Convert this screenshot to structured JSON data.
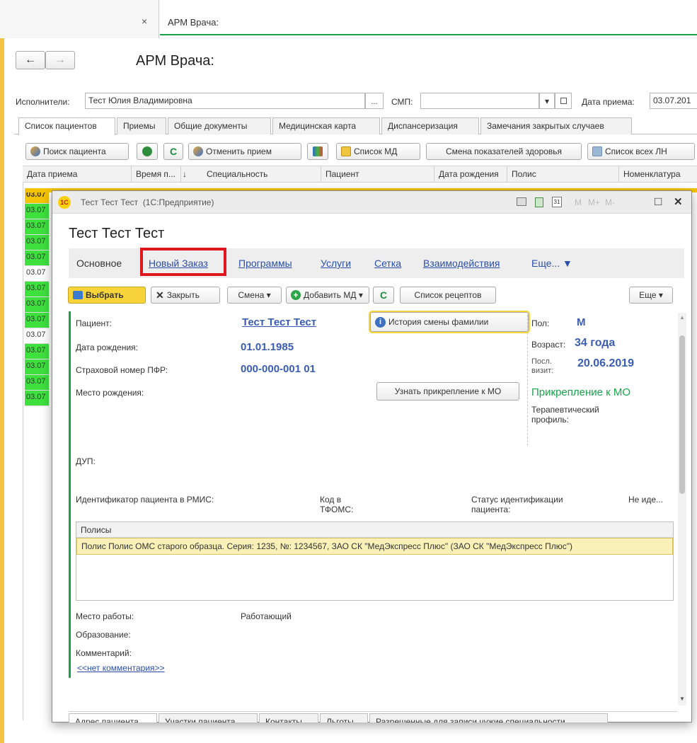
{
  "window_tab": {
    "close": "×",
    "label": "АРМ Врача:"
  },
  "page": {
    "back": "←",
    "forward": "→",
    "title": "АРМ Врача:"
  },
  "filters": {
    "executors_label": "Исполнители:",
    "executors_value": "Тест Юлия Владимировна",
    "ellipsis": "...",
    "smp_label": "СМП:",
    "smp_value": "",
    "dropdown": "▾",
    "date_label": "Дата приема:",
    "date_value": "03.07.201"
  },
  "main_tabs": [
    "Список пациентов",
    "Приемы",
    "Общие документы",
    "Медицинская карта",
    "Диспансеризация",
    "Замечания закрытых случаев"
  ],
  "toolbar": {
    "search_patient": "Поиск пациента",
    "cancel_reception": "Отменить прием",
    "md_list": "Список МД",
    "health_change": "Смена показателей здоровья",
    "ln_list": "Список всех ЛН"
  },
  "table": {
    "headers": [
      "Дата приема",
      "Время п...",
      "↓",
      "Специальность",
      "Пациент",
      "Дата рождения",
      "Полис",
      "Номенклатура"
    ],
    "rows": [
      "03.07",
      "03.07",
      "03.07",
      "03.07",
      "03.07",
      "03.07",
      "03.07",
      "03.07",
      "03.07",
      "03.07",
      "03.07",
      "03.07",
      "03.07",
      "03.07"
    ]
  },
  "colors": {
    "accent_green": "#18a34a",
    "row_yellow": "#f5c400",
    "row_green": "#3ee03e",
    "highlight_red": "#e0161e"
  },
  "dialog": {
    "title": "Тест Тест Тест  (1С:Предприятие)",
    "logo": "1С",
    "title_buttons": [
      "M",
      "M+",
      "M-"
    ],
    "maximize": "□",
    "close": "✕",
    "heading": "Тест Тест Тест",
    "nav": {
      "main": "Основное",
      "new_order": "Новый Заказ",
      "programs": "Программы",
      "services": "Услуги",
      "grid": "Сетка",
      "interactions": "Взаимодействия",
      "more": "Еще... ▼"
    },
    "toolbar": {
      "select": "Выбрать",
      "close": "Закрыть",
      "shift": "Смена ▾",
      "add_md": "Добавить МД ▾",
      "recipes": "Список рецептов",
      "more": "Еще ▾"
    },
    "patient_label": "Пациент:",
    "patient_value": "Тест Тест Тест",
    "history_button": "История смены фамилии",
    "birth_label": "Дата рождения:",
    "birth_value": "01.01.1985",
    "pfr_label": "Страховой номер ПФР:",
    "pfr_value": "000-000-001 01",
    "birthplace_label": "Место рождения:",
    "attach_button": "Узнать прикрепление к МО",
    "sex_label": "Пол:",
    "sex_value": "М",
    "age_label": "Возраст:",
    "age_value": "34 года",
    "last_visit_label1": "Посл.",
    "last_visit_label2": "визит:",
    "last_visit_value": "20.06.2019",
    "attach_mo": "Прикрепление к МО",
    "profile_label1": "Терапевтический",
    "profile_label2": "профиль:",
    "dup_label": "ДУП:",
    "rmis_label": "Идентификатор пациента в РМИС:",
    "tfoms_label1": "Код в",
    "tfoms_label2": "ТФОМС:",
    "ident_status_label1": "Статус идентификации",
    "ident_status_label2": "пациента:",
    "ident_status_value": "Не иде...",
    "policies_header": "Полисы",
    "policy_row": "Полис Полис ОМС старого образца. Серия: 1235, №: 1234567, ЗАО СК \"МедЭкспресс Плюс\" (ЗАО СК \"МедЭкспресс Плюс\")",
    "work_label": "Место работы:",
    "work_value": "Работающий",
    "education_label": "Образование:",
    "comment_label": "Комментарий:",
    "comment_link": "<<нет комментария>>",
    "bottom_tabs": [
      "Адрес пациента",
      "Участки пациента",
      "Контакты",
      "Льготы",
      "Разрешенные для записи чужие специальности"
    ]
  }
}
